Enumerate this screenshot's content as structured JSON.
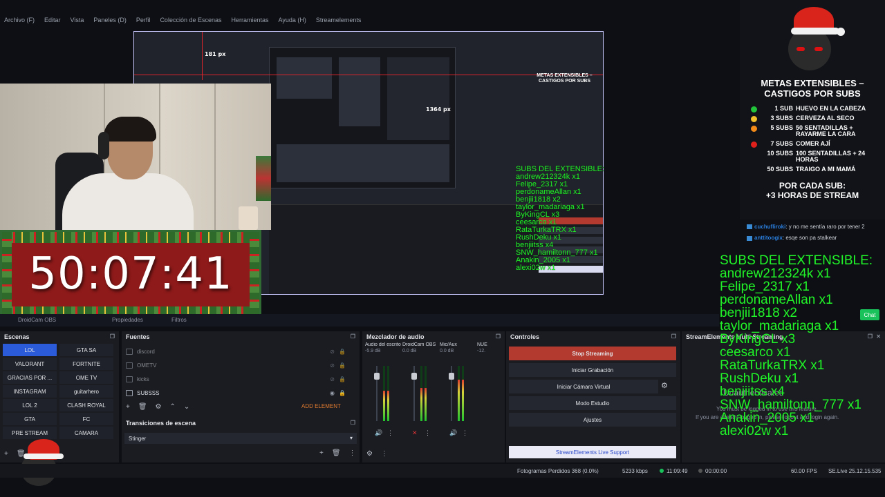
{
  "menu": [
    "Archivo (F)",
    "Editar",
    "Vista",
    "Paneles (D)",
    "Perfil",
    "Colección de Escenas",
    "Herramientas",
    "Ayuda (H)",
    "Streamelements"
  ],
  "preview": {
    "px_label_top": "181 px",
    "px_label_right": "1364 px"
  },
  "timer": {
    "value": "50:07:41"
  },
  "dockbar": {
    "tab1": "DroidCam OBS",
    "tab2": "Propiedades",
    "tab3": "Filtros"
  },
  "scenes": {
    "title": "Escenas",
    "items": [
      "LOL",
      "GTA SA",
      "VALORANT",
      "FORTNITE",
      "GRACIAS POR ...",
      "OME TV",
      "INSTAGRAM",
      "guitarhero",
      "LOL 2",
      "CLASH ROYAL",
      "GTA",
      "FC",
      "PRE STREAM",
      "CAMARA"
    ],
    "active": "LOL"
  },
  "sources": {
    "title": "Fuentes",
    "items": [
      "discord",
      "OMETV",
      "kicks",
      "SUBSSS"
    ],
    "add_element": "ADD ELEMENT"
  },
  "transitions": {
    "title": "Transiciones de escena",
    "value": "Stinger"
  },
  "mixer": {
    "title": "Mezclador de audio",
    "channels": [
      {
        "name": "Audio del escritorio",
        "db": "-5.9 dB",
        "level": 0.55
      },
      {
        "name": "DroidCam OBS",
        "db": "0.0 dB",
        "level": 0.6
      },
      {
        "name": "Mic/Aux",
        "db": "0.0 dB",
        "level": 0.75
      },
      {
        "name": "NUE",
        "db": "-12.",
        "level": 0.2
      }
    ]
  },
  "controls": {
    "title": "Controles",
    "stop_streaming": "Stop Streaming",
    "start_recording": "Iniciar Grabación",
    "virtual_cam": "Iniciar Cámara Virtual",
    "studio_mode": "Modo Estudio",
    "settings": "Ajustes",
    "se_support": "StreamElements Live Support"
  },
  "se_dock": {
    "title": "StreamElements Multi Streaming",
    "unauth": "Unauthenticated",
    "line1": "You must be logged in to use this feature.",
    "line2": "If you are already logged in, please logout and login again."
  },
  "metas": {
    "title_line1": "METAS EXTENSIBLES –",
    "title_line2": "CASTIGOS POR SUBS",
    "rows": [
      {
        "subs": "1 SUB",
        "text": "HUEVO EN LA CABEZA",
        "color": "#22c43a"
      },
      {
        "subs": "3 SUBS",
        "text": "CERVEZA AL SECO",
        "color": "#f2c02a"
      },
      {
        "subs": "5 SUBS",
        "text": "50 SENTADILLAS + RAYARME LA CARA",
        "color": "#f28a1a"
      },
      {
        "subs": "7 SUBS",
        "text": "COMER AJÍ",
        "color": "#e0201a"
      },
      {
        "subs": "10 SUBS",
        "text": "100 SENTADILLAS + 24 HORAS",
        "color": ""
      },
      {
        "subs": "50 SUBS",
        "text": "TRAIGO A MI MAMÁ",
        "color": ""
      }
    ],
    "per_sub_line1": "POR CADA SUB:",
    "per_sub_line2": "+3 HORAS DE STREAM"
  },
  "chat": {
    "messages": [
      {
        "user": "cuchufliroki",
        "text": ": y no me sentía raro por tener 2"
      },
      {
        "user": "anttitoogix",
        "text": ": esqe son pa stalkear"
      }
    ],
    "button": "Chat"
  },
  "subs_list": {
    "title": "SUBS DEL EXTENSIBLE:",
    "items": [
      "andrew212324k x1",
      "Felipe_2317 x1",
      "perdonameAllan x1",
      "benjii1818 x2",
      "taylor_madariaga x1",
      "ByKingCL x3",
      "ceesarco x1",
      "RataTurkaTRX x1",
      "RushDeku x1",
      "benjiitss x4",
      "SNW_hamiltonn_777 x1",
      "Anakin_2005 x1",
      "alexi02w x1"
    ]
  },
  "status": {
    "dropped": "Fotogramas Perdidos 368 (0.0%)",
    "bitrate": "5233 kbps",
    "live_time": "11:09:49",
    "rec_time": "00:00:00",
    "cpu_fps": "60.00 FPS",
    "se_live": "SE.Live 25.12.15.535"
  }
}
